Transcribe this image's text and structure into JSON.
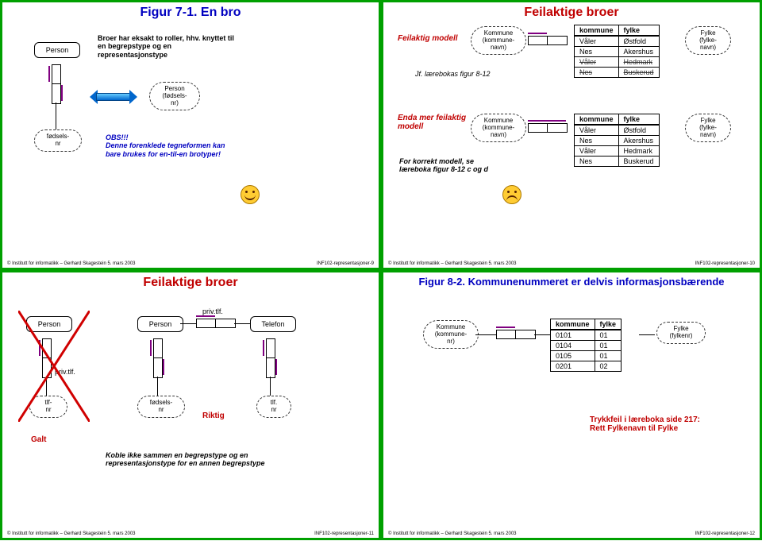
{
  "slides": {
    "s1": {
      "title": "Figur 7-1. En bro",
      "person": "Person",
      "person_id": "Person\n(fødsels-\nnr)",
      "fodselsnr": "fødsels-\nnr",
      "bridge_note": "Broer har eksakt to roller, hhv. knyttet til en begrepstype og en representasjonstype",
      "obs": "OBS!!!\nDenne forenklede tegneformen kan bare brukes for en-til-en brotyper!",
      "footer_left": "© Institutt for informatikk – Gerhard Skagestein 5. mars 2003",
      "footer_right": "INF102-representasjoner-9"
    },
    "s2": {
      "title": "Feilaktige broer",
      "feilaktig": "Feilaktig modell",
      "jf": "Jf. lærebokas figur 8-12",
      "enda": "Enda mer feilaktig modell",
      "korrekt": "For korrekt modell, se læreboka figur 8-12 c og d",
      "kommune_label": "Kommune\n(kommune-\nnavn)",
      "fylke_label": "Fylke\n(fylke-\nnavn)",
      "th_kommune": "kommune",
      "th_fylke": "fylke",
      "rows1": [
        [
          "Våler",
          "Østfold"
        ],
        [
          "Nes",
          "Akershus"
        ],
        [
          "Våler",
          "Hedmark"
        ],
        [
          "Nes",
          "Buskerud"
        ]
      ],
      "rows2": [
        [
          "Våler",
          "Østfold"
        ],
        [
          "Nes",
          "Akershus"
        ],
        [
          "Våler",
          "Hedmark"
        ],
        [
          "Nes",
          "Buskerud"
        ]
      ],
      "footer_left": "© Institutt for informatikk – Gerhard Skagestein 5. mars 2003",
      "footer_right": "INF102-representasjoner-10"
    },
    "s3": {
      "title": "Feilaktige broer",
      "person": "Person",
      "telefon": "Telefon",
      "privtlf": "priv.tlf.",
      "tlfnr": "tlf-\nnr",
      "tlf_nr2": "tlf.\nnr",
      "fodselsnr": "fødsels-\nnr",
      "galt": "Galt",
      "riktig": "Riktig",
      "koble": "Koble ikke sammen en begrepstype og en representasjonstype for en annen begrepstype",
      "footer_left": "© Institutt for informatikk – Gerhard Skagestein 5. mars 2003",
      "footer_right": "INF102-representasjoner-11"
    },
    "s4": {
      "title": "Figur 8-2. Kommunenummeret er delvis informasjonsbærende",
      "kommune_label": "Kommune\n(kommune-\nnr)",
      "fylke_label": "Fylke\n(fylkenr)",
      "th_kommune": "kommune",
      "th_fylke": "fylke",
      "rows": [
        [
          "0101",
          "01"
        ],
        [
          "0104",
          "01"
        ],
        [
          "0105",
          "01"
        ],
        [
          "0201",
          "02"
        ]
      ],
      "trykkfeil": "Trykkfeil i læreboka side 217:\nRett Fylkenavn til Fylke",
      "footer_left": "© Institutt for informatikk – Gerhard Skagestein 5. mars 2003",
      "footer_right": "INF102-representasjoner-12"
    }
  }
}
